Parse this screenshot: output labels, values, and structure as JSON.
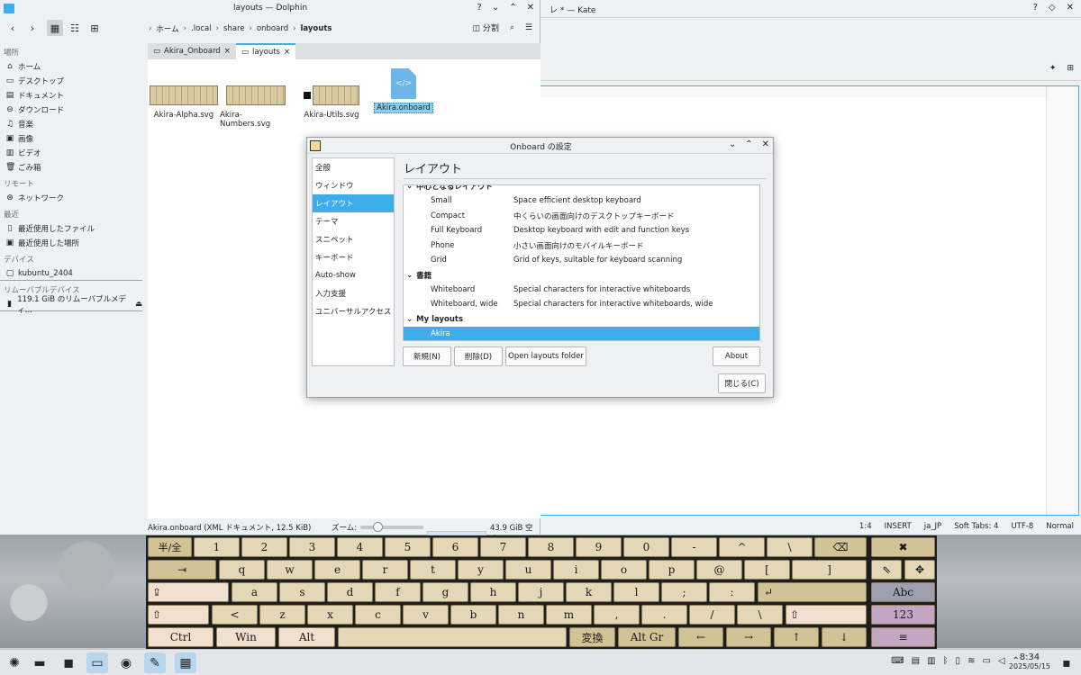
{
  "kate": {
    "title": "レ * — Kate",
    "status": [
      "1:4",
      "INSERT",
      "ja_JP",
      "Soft Tabs: 4",
      "UTF-8",
      "Normal"
    ]
  },
  "dolphin": {
    "title": "layouts — Dolphin",
    "split_label": "分割",
    "breadcrumb": [
      "ホーム",
      ".local",
      "share",
      "onboard",
      "layouts"
    ],
    "sidebar": {
      "places_header": "場所",
      "places": [
        {
          "label": "ホーム",
          "icon": "home-icon"
        },
        {
          "label": "デスクトップ",
          "icon": "desktop-icon"
        },
        {
          "label": "ドキュメント",
          "icon": "documents-icon"
        },
        {
          "label": "ダウンロード",
          "icon": "downloads-icon"
        },
        {
          "label": "音楽",
          "icon": "music-icon"
        },
        {
          "label": "画像",
          "icon": "pictures-icon"
        },
        {
          "label": "ビデオ",
          "icon": "videos-icon"
        },
        {
          "label": "ごみ箱",
          "icon": "trash-icon"
        }
      ],
      "remote_header": "リモート",
      "remote": [
        {
          "label": "ネットワーク",
          "icon": "network-icon"
        }
      ],
      "recent_header": "最近",
      "recent": [
        {
          "label": "最近使用したファイル",
          "icon": "recent-files-icon"
        },
        {
          "label": "最近使用した場所",
          "icon": "recent-places-icon"
        }
      ],
      "devices_header": "デバイス",
      "devices": [
        {
          "label": "kubuntu_2404",
          "icon": "drive-icon"
        }
      ],
      "removable_header": "リムーバブルデバイス",
      "removable": [
        {
          "label": "119.1 GiB のリムーバブルメディ...",
          "icon": "usb-drive-icon"
        }
      ]
    },
    "tabs": [
      "Akira_Onboard",
      "layouts"
    ],
    "files": [
      "Akira-Alpha.svg",
      "Akira-Numbers.svg",
      "Akira-Utils.svg",
      "Akira.onboard"
    ],
    "status": {
      "selection": "Akira.onboard (XML ドキュメント, 12.5 KiB)",
      "zoom_label": "ズーム:",
      "free_space": "43.9 GiB 空き"
    }
  },
  "dialog": {
    "title": "Onboard の設定",
    "nav": [
      "全般",
      "ウィンドウ",
      "レイアウト",
      "テーマ",
      "スニペット",
      "キーボード",
      "Auto-show",
      "入力支援",
      "ユニバーサルアクセス"
    ],
    "selected_nav": "レイアウト",
    "panel_title": "レイアウト",
    "groups": [
      {
        "name": "中心となるレイアウト",
        "rows": [
          {
            "name": "Small",
            "desc": "Space efficient desktop keyboard"
          },
          {
            "name": "Compact",
            "desc": "中くらいの画面向けのデスクトップキーボード"
          },
          {
            "name": "Full Keyboard",
            "desc": "Desktop keyboard with edit and function keys"
          },
          {
            "name": "Phone",
            "desc": "小さい画面向けのモバイルキーボード"
          },
          {
            "name": "Grid",
            "desc": "Grid of keys, suitable for keyboard scanning"
          }
        ]
      },
      {
        "name": "書籍",
        "rows": [
          {
            "name": "Whiteboard",
            "desc": "Special characters for interactive whiteboards"
          },
          {
            "name": "Whiteboard, wide",
            "desc": "Special characters for interactive whiteboards, wide"
          }
        ]
      },
      {
        "name": "My layouts",
        "rows": [
          {
            "name": "Akira",
            "desc": ""
          }
        ]
      }
    ],
    "buttons": {
      "new": "新規(N)",
      "delete": "削除(D)",
      "open_folder": "Open layouts folder",
      "about": "About",
      "close": "閉じる(C)"
    }
  },
  "keyboard": {
    "row1": [
      "半/全",
      "1",
      "2",
      "3",
      "4",
      "5",
      "6",
      "7",
      "8",
      "9",
      "0",
      "-",
      "^",
      "\\",
      "⌫",
      "✖"
    ],
    "row2": [
      "⇥",
      "q",
      "w",
      "e",
      "r",
      "t",
      "y",
      "u",
      "i",
      "o",
      "p",
      "@",
      "[",
      "]"
    ],
    "row3": [
      "⇪",
      "a",
      "s",
      "d",
      "f",
      "g",
      "h",
      "j",
      "k",
      "l",
      ";",
      ":",
      "↵",
      "Abc"
    ],
    "row4": [
      "⇧",
      "<",
      "z",
      "x",
      "c",
      "v",
      "b",
      "n",
      "m",
      ",",
      ".",
      "/",
      "\\",
      "⇧",
      "123"
    ],
    "row5": [
      "Ctrl",
      "Win",
      "Alt",
      "",
      "変換",
      "Alt Gr",
      "←",
      "→",
      "↑",
      "↓",
      "≡"
    ]
  },
  "taskbar": {
    "time": "8:34",
    "date": "2025/05/15"
  },
  "colors": {
    "accent": "#3daee9",
    "key_face": "#e3d7b5",
    "key_pink": "#f1dfd0",
    "key_lavender": "#c4a6c2",
    "key_gray": "#9ea0ad"
  }
}
